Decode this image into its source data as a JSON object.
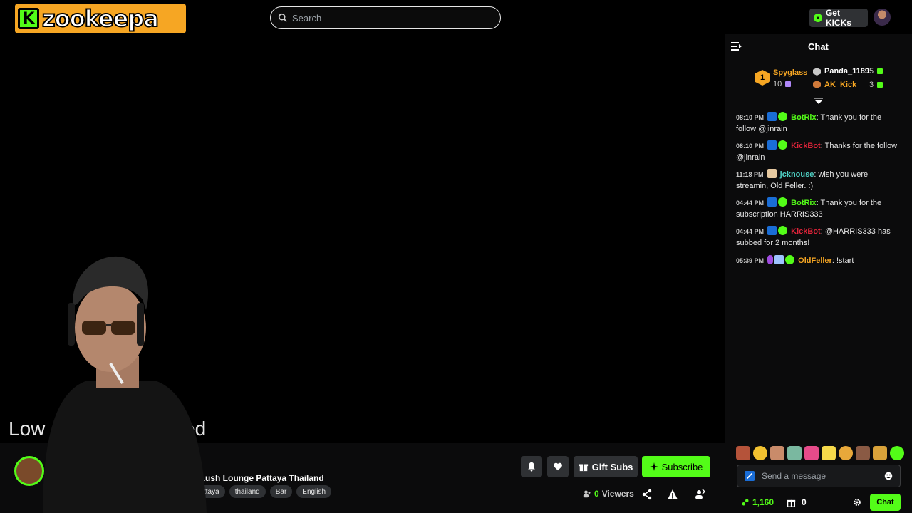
{
  "header": {
    "logo_letter": "K",
    "logo_text": "zookeepa",
    "search_placeholder": "Search",
    "get_kicks_label": "Get KICKs"
  },
  "video": {
    "offline_text_start": "Low",
    "offline_text_end": "ed"
  },
  "stream": {
    "title": "r. Lush Lounge Pattaya Thailand",
    "tags": [
      "ttaya",
      "thailand",
      "Bar",
      "English"
    ],
    "gift_subs_label": "Gift Subs",
    "subscribe_label": "Subscribe",
    "viewers_count": "0",
    "viewers_label": "Viewers"
  },
  "chat": {
    "title": "Chat",
    "leaderboard": {
      "first": {
        "rank": "1",
        "name": "Spyglass",
        "count": "10"
      },
      "second": {
        "name": "Panda_1189",
        "count": "5"
      },
      "third": {
        "name": "AK_Kick",
        "count": "3"
      }
    },
    "messages": [
      {
        "time": "08:10 PM",
        "user": "BotRix",
        "text": ": Thank you for the follow @jinrain",
        "color": "#53fc18"
      },
      {
        "time": "08:10 PM",
        "user": "KickBot",
        "text": ": Thanks for the follow @jinrain",
        "color": "#e0243a"
      },
      {
        "time": "11:18 PM",
        "user": "jcknouse",
        "text": ": wish you were streamin, Old Feller. :)",
        "color": "#4fd1c5"
      },
      {
        "time": "04:44 PM",
        "user": "BotRix",
        "text": ": Thank you for the subscription HARRIS333",
        "color": "#53fc18"
      },
      {
        "time": "04:44 PM",
        "user": "KickBot",
        "text": ": @HARRIS333 has subbed for 2 months!",
        "color": "#e0243a"
      },
      {
        "time": "05:39 PM",
        "user": "OldFeller",
        "text": ": !start",
        "color": "#f6a623"
      }
    ],
    "input_placeholder": "Send a message",
    "points": "1,160",
    "gifts": "0",
    "send_label": "Chat"
  },
  "colors": {
    "accent": "#53fc18",
    "gold": "#f6a623"
  }
}
